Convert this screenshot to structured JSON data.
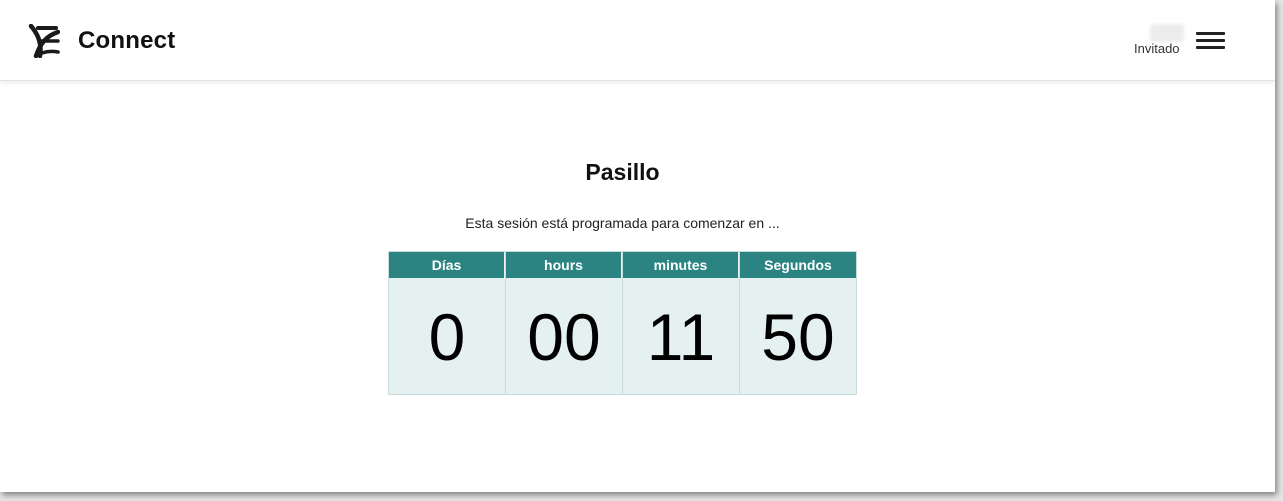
{
  "header": {
    "brand_name": "Connect",
    "logo_icon": "connect-logo-icon",
    "user_label": "Invitado",
    "menu_icon": "hamburger-menu-icon"
  },
  "session": {
    "title": "Pasillo",
    "subtitle": "Esta sesión está programada para comenzar en ..."
  },
  "countdown": [
    {
      "label": "Días",
      "value": "0"
    },
    {
      "label": "hours",
      "value": "00"
    },
    {
      "label": "minutes",
      "value": "11"
    },
    {
      "label": "Segundos",
      "value": "50"
    }
  ],
  "colors": {
    "header_cell_bg": "#2b8482",
    "value_cell_bg": "#e5f1f0",
    "text": "#111111"
  }
}
